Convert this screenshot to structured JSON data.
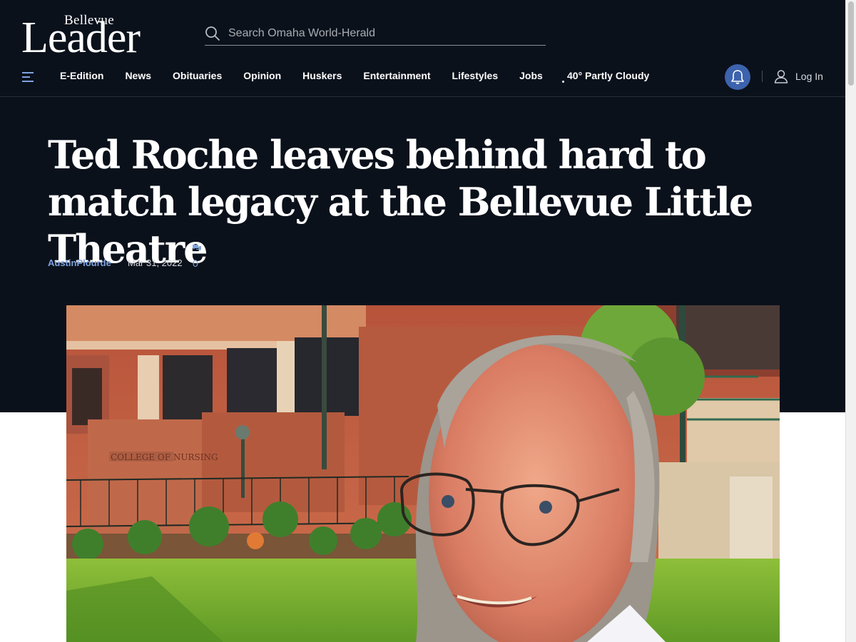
{
  "brand": {
    "name_small": "Bellevue",
    "name_large": "Leader"
  },
  "search": {
    "placeholder": "Search Omaha World-Herald",
    "icon": "search-icon"
  },
  "nav": {
    "items": [
      "E-Edition",
      "News",
      "Obituaries",
      "Opinion",
      "Huskers",
      "Entertainment",
      "Lifestyles",
      "Jobs"
    ],
    "weather": "40° Partly Cloudy",
    "login_label": "Log In",
    "accent_color": "#3c63ad"
  },
  "article": {
    "headline": "Ted Roche leaves behind hard to match legacy at the Bellevue Little Theatre",
    "author": "AustinPlourde",
    "date": "Mar 31, 2022",
    "comment_count": "0"
  },
  "photo": {
    "sign_text": "COLLEGE OF NURSING"
  },
  "colors": {
    "header_bg": "#0b111b",
    "link_blue": "#7ea3e0"
  }
}
